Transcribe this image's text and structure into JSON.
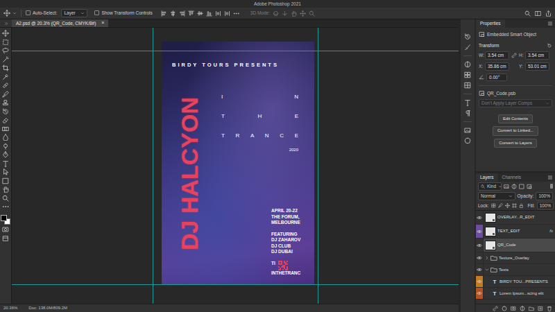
{
  "window": {
    "title": "Adobe Photoshop 2021"
  },
  "options_bar": {
    "auto_select": {
      "label": "Auto-Select:",
      "checked": false
    },
    "target": "Layer",
    "transform_controls": {
      "label": "Show Transform Controls",
      "checked": false
    },
    "mode_3d": {
      "label": "3D Mode:",
      "disabled": true
    }
  },
  "document_tabs": [
    {
      "label": "A2.psd @ 20.3% (QR_Code, CMYK/8#)",
      "close": "×",
      "selected": true
    }
  ],
  "poster": {
    "presenter": "BIRDY TOURS PRESENTS",
    "headline": "DJ HALCYON",
    "title_lines": [
      "IN",
      "THE",
      "TRANCE"
    ],
    "year": "2020",
    "details": [
      "APRIL 20-22",
      "THE FORUM,",
      "MELBOURNE"
    ],
    "featuring": "FEATURING",
    "artists": [
      "DJ ZAHAROV",
      "DJ CLUB",
      "DJ DUBAI"
    ],
    "tickets_label": "TI",
    "tickets_url": "INTHETRANC"
  },
  "properties": {
    "tab": "Properties",
    "object_type": "Embedded Smart Object",
    "section": "Transform",
    "size": [
      {
        "label": "W:",
        "value": "3.54 cm"
      },
      {
        "label": "H:",
        "value": "3.54 cm"
      }
    ],
    "position": [
      {
        "label": "X:",
        "value": "35.86 cm"
      },
      {
        "label": "Y:",
        "value": "53.01 cm"
      }
    ],
    "angle": "0.00°",
    "file": "QR_Code.psb",
    "layer_comps": {
      "value": "Don't Apply Layer Comps",
      "disabled": true
    },
    "buttons": [
      "Edit Contents",
      "Convert to Linked...",
      "Convert to Layers"
    ]
  },
  "layers_panel": {
    "tabs": [
      {
        "label": "Layers",
        "selected": true
      },
      {
        "label": "Channels",
        "selected": false
      }
    ],
    "filter": "Kind",
    "blend_mode": "Normal",
    "opacity": {
      "label": "Opacity:",
      "value": "100%"
    },
    "lock_label": "Lock:",
    "fill": {
      "label": "Fill:",
      "value": "100%"
    },
    "layers": [
      {
        "name": "OVERLAY...R_EDIT",
        "kind": "smart",
        "visible": true,
        "selected": false,
        "color": "#323232"
      },
      {
        "name": "TEXT_EDIT",
        "kind": "smart",
        "visible": true,
        "selected": false,
        "color": "#6b4f9e",
        "effects": "fx"
      },
      {
        "name": "QR_Code",
        "kind": "smart",
        "visible": true,
        "selected": true,
        "color": "#323232"
      },
      {
        "name": "Texture_Overlay",
        "kind": "group",
        "visible": true,
        "selected": false,
        "expanded": false,
        "color": "#323232"
      },
      {
        "name": "Texts",
        "kind": "group",
        "visible": true,
        "selected": false,
        "expanded": true,
        "color": "#323232",
        "children": [
          {
            "name": "BIRDY TOU...PRESENTS",
            "kind": "text",
            "glyph": "T",
            "visible": true,
            "selected": false,
            "color": "#c47a1e"
          },
          {
            "name": "Lorem Ipsum...scing elit",
            "kind": "text",
            "glyph": "T",
            "visible": true,
            "selected": false,
            "color": "#b5521d"
          }
        ]
      }
    ]
  },
  "status_bar": {
    "zoom": "20.36%",
    "doc_size": "Doc: 138.0M/809.2M"
  }
}
